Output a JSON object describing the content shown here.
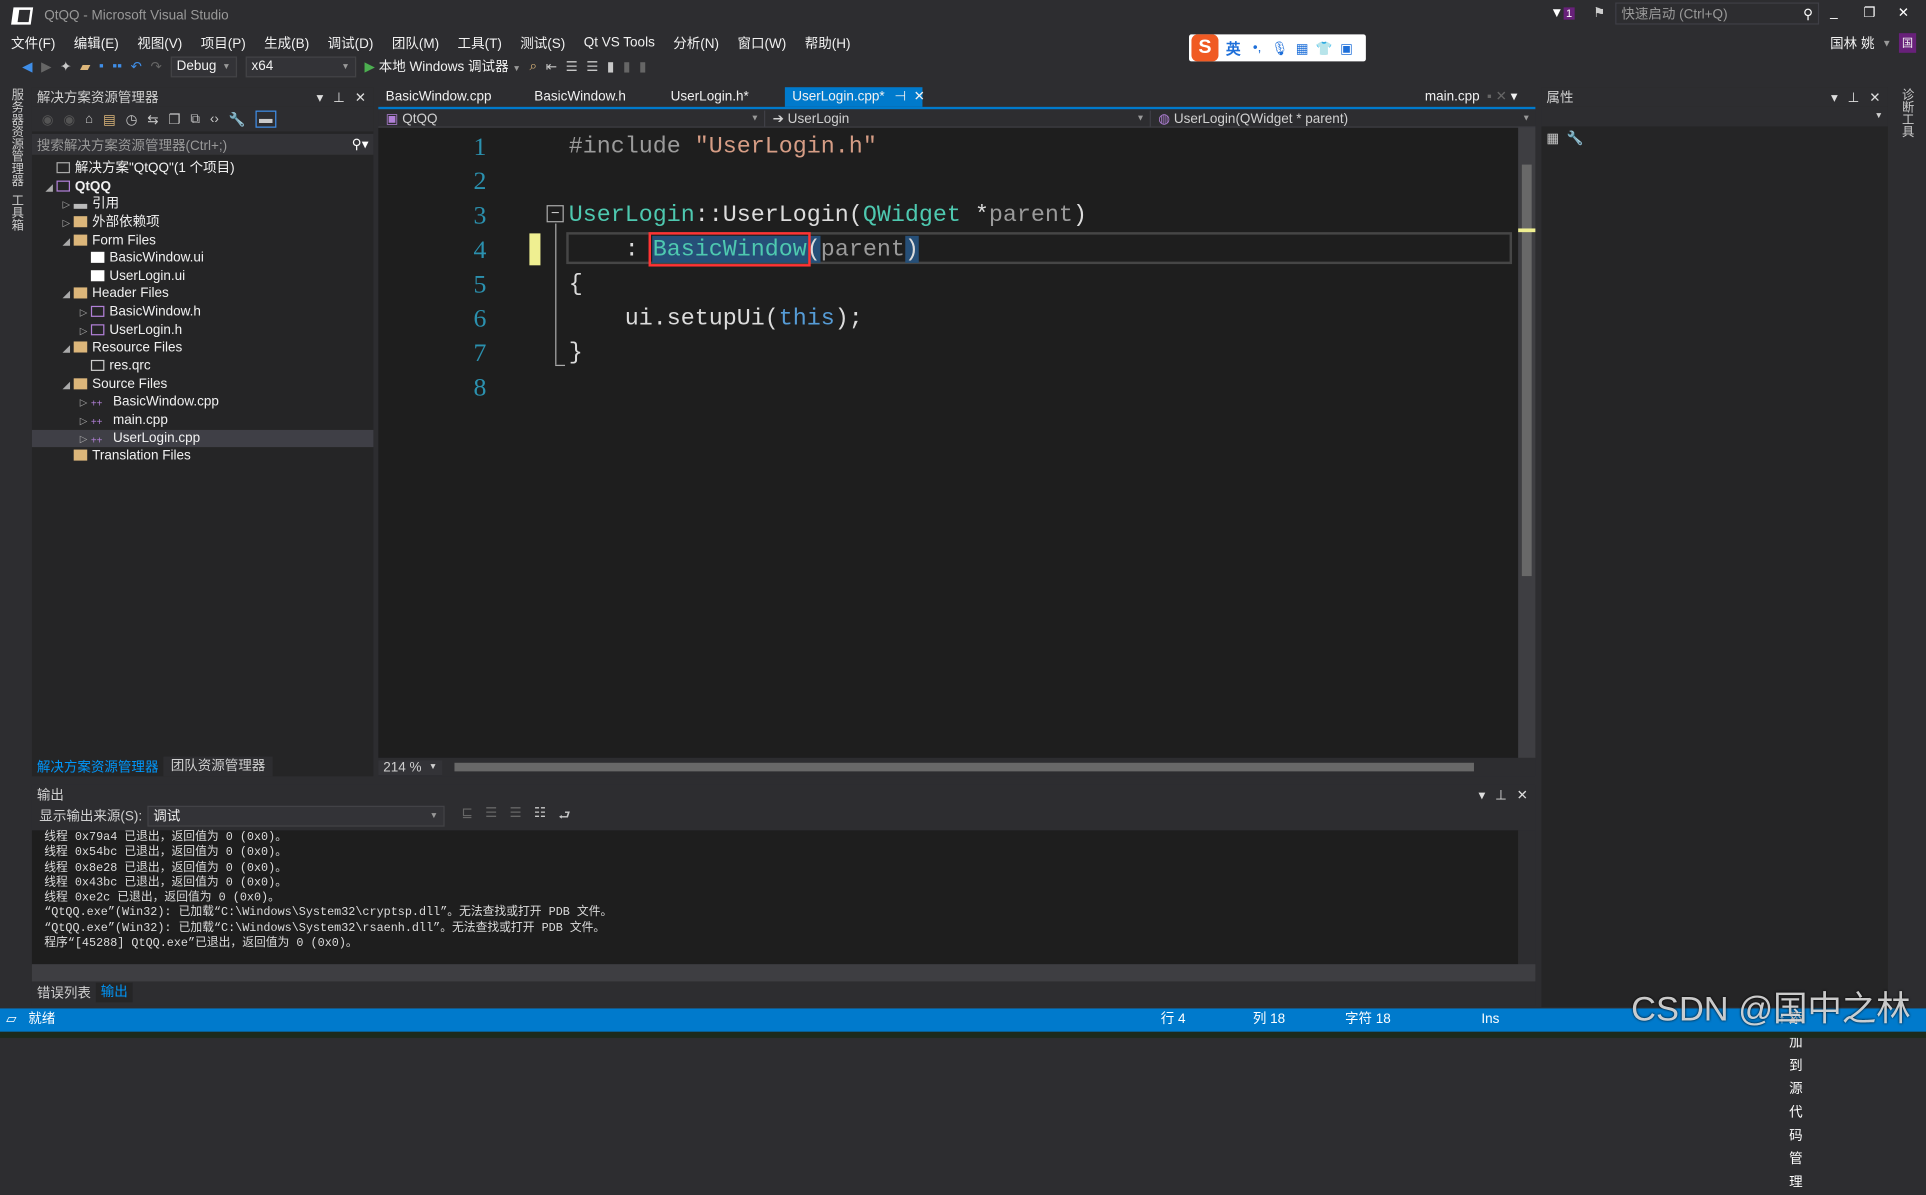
{
  "window": {
    "title": "QtQQ - Microsoft Visual Studio",
    "quick_launch_placeholder": "快速启动 (Ctrl+Q)",
    "notification_count": "1",
    "user": "国林 姚",
    "user_initial": "国"
  },
  "menu": [
    "文件(F)",
    "编辑(E)",
    "视图(V)",
    "项目(P)",
    "生成(B)",
    "调试(D)",
    "团队(M)",
    "工具(T)",
    "测试(S)",
    "Qt VS Tools",
    "分析(N)",
    "窗口(W)",
    "帮助(H)"
  ],
  "toolbar": {
    "config": "Debug",
    "platform": "x64",
    "debugger": "本地 Windows 调试器"
  },
  "ime": {
    "lang": "英"
  },
  "left_strip": [
    "服务器资源管理器",
    "工具箱"
  ],
  "right_strip": "诊断工具",
  "solution_explorer": {
    "title": "解决方案资源管理器",
    "search_placeholder": "搜索解决方案资源管理器(Ctrl+;)",
    "items": [
      {
        "label": "解决方案\"QtQQ\"(1 个项目)",
        "level": 0,
        "icon": "solution-icon"
      },
      {
        "label": "QtQQ",
        "level": 0,
        "icon": "project-icon",
        "expanded": true
      },
      {
        "label": "引用",
        "level": 1,
        "icon": "references-icon",
        "expanded": false
      },
      {
        "label": "外部依赖项",
        "level": 1,
        "icon": "external-deps-icon",
        "expanded": false
      },
      {
        "label": "Form Files",
        "level": 1,
        "icon": "folder-icon",
        "expanded": true
      },
      {
        "label": "BasicWindow.ui",
        "level": 2,
        "icon": "ui-file-icon"
      },
      {
        "label": "UserLogin.ui",
        "level": 2,
        "icon": "ui-file-icon"
      },
      {
        "label": "Header Files",
        "level": 1,
        "icon": "folder-icon",
        "expanded": true
      },
      {
        "label": "BasicWindow.h",
        "level": 2,
        "icon": "header-file-icon",
        "expanded": false
      },
      {
        "label": "UserLogin.h",
        "level": 2,
        "icon": "header-file-icon",
        "expanded": false
      },
      {
        "label": "Resource Files",
        "level": 1,
        "icon": "folder-icon",
        "expanded": true
      },
      {
        "label": "res.qrc",
        "level": 2,
        "icon": "file-icon"
      },
      {
        "label": "Source Files",
        "level": 1,
        "icon": "folder-icon",
        "expanded": true
      },
      {
        "label": "BasicWindow.cpp",
        "level": 2,
        "icon": "cpp-file-icon",
        "expanded": false
      },
      {
        "label": "main.cpp",
        "level": 2,
        "icon": "cpp-file-icon",
        "expanded": false
      },
      {
        "label": "UserLogin.cpp",
        "level": 2,
        "icon": "cpp-file-icon",
        "expanded": false,
        "selected": true
      },
      {
        "label": "Translation Files",
        "level": 1,
        "icon": "folder-icon"
      }
    ],
    "bottom_tabs": [
      "解决方案资源管理器",
      "团队资源管理器"
    ]
  },
  "editor": {
    "tabs": [
      "BasicWindow.cpp",
      "BasicWindow.h",
      "UserLogin.h*",
      "UserLogin.cpp*"
    ],
    "active_tab": "UserLogin.cpp*",
    "right_tab": "main.cpp",
    "nav": {
      "project": "QtQQ",
      "scope": "UserLogin",
      "member": "UserLogin(QWidget * parent)"
    },
    "line_numbers": [
      "1",
      "2",
      "3",
      "4",
      "5",
      "6",
      "7",
      "8"
    ],
    "code": {
      "l1_kw": "#include ",
      "l1_str": "\"UserLogin.h\"",
      "l3_type": "UserLogin",
      "l3_mid": "::UserLogin(",
      "l3_type2": "QWidget",
      "l3_star": " *",
      "l3_param": "parent",
      "l3_end": ")",
      "l4_colon": "    : ",
      "l4_sel": "BasicWindow",
      "l4_paren": "(",
      "l4_param": "parent",
      "l4_end": ")",
      "l5": "{",
      "l6_a": "    ui.setupUi(",
      "l6_kw": "this",
      "l6_b": ");",
      "l7": "}"
    },
    "zoom": "214 %"
  },
  "properties": {
    "title": "属性"
  },
  "output": {
    "title": "输出",
    "source_label": "显示输出来源(S):",
    "source_value": "调试",
    "lines": [
      "线程 0x79a4 已退出，返回值为 0 (0x0)。",
      "线程 0x54bc 已退出，返回值为 0 (0x0)。",
      "线程 0x8e28 已退出，返回值为 0 (0x0)。",
      "线程 0x43bc 已退出，返回值为 0 (0x0)。",
      "线程 0xe2c 已退出，返回值为 0 (0x0)。",
      "“QtQQ.exe”(Win32): 已加载“C:\\Windows\\System32\\cryptsp.dll”。无法查找或打开 PDB 文件。",
      "“QtQQ.exe”(Win32): 已加载“C:\\Windows\\System32\\rsaenh.dll”。无法查找或打开 PDB 文件。",
      "程序“[45288] QtQQ.exe”已退出，返回值为 0 (0x0)。"
    ],
    "bottom_tabs": [
      "错误列表",
      "输出"
    ]
  },
  "status": {
    "ready": "就绪",
    "line": "行 4",
    "col": "列 18",
    "char": "字符 18",
    "mode": "Ins",
    "source_control": "添加到源代码管理"
  },
  "watermark": "CSDN @国中之林",
  "colors": {
    "accent": "#007acc",
    "status_bar": "#007acc",
    "selection": "#264f78",
    "highlight_box": "#ff3333"
  }
}
